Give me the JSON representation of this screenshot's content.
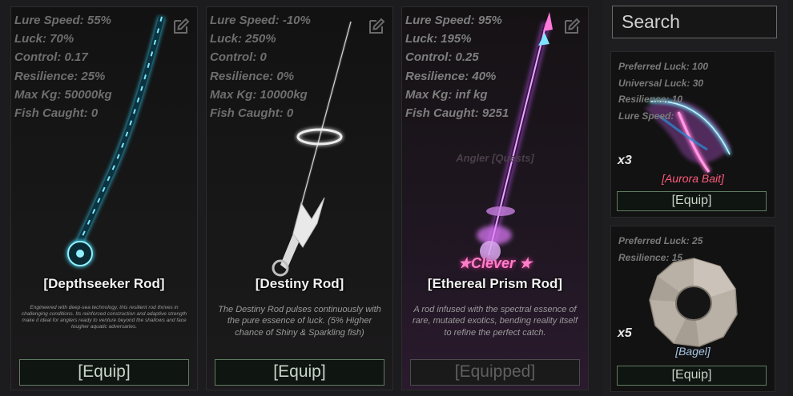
{
  "rods": [
    {
      "stats": [
        "Lure Speed: 55%",
        "Luck: 70%",
        "Control: 0.17",
        "Resilience: 25%",
        "Max Kg: 50000kg",
        "Fish Caught: 0"
      ],
      "name": "[Depthseeker Rod]",
      "description": "Engineered with deep-sea technology, this resilient rod thrives in challenging conditions. Its reinforced construction and adaptive strength make it ideal for anglers ready to venture beyond the shallows and face tougher aquatic adversaries.",
      "button_label": "[Equip]",
      "equipped": false
    },
    {
      "stats": [
        "Lure Speed: -10%",
        "Luck: 250%",
        "Control: 0",
        "Resilience: 0%",
        "Max Kg: 10000kg",
        "Fish Caught: 0"
      ],
      "name": "[Destiny Rod]",
      "description": "The Destiny Rod pulses continuously with the pure essence of luck. (5% Higher chance of Shiny & Sparkling fish)",
      "button_label": "[Equip]",
      "equipped": false
    },
    {
      "stats": [
        "Lure Speed: 95%",
        "Luck: 195%",
        "Control: 0.25",
        "Resilience: 40%",
        "Max Kg: inf kg",
        "Fish Caught: 9251"
      ],
      "name": "[Ethereal Prism Rod]",
      "mutation": "★Clever ★",
      "npc_label": "Angler [Quests]",
      "description": "A rod infused with the spectral essence of rare, mutated exotics, bending reality itself to refine the perfect catch.",
      "button_label": "[Equipped]",
      "equipped": true
    }
  ],
  "search": {
    "placeholder": "Search"
  },
  "baits": [
    {
      "stats": [
        "Preferred Luck: 100",
        "Universal Luck: 30",
        "Resilience: 10",
        "Lure Speed:"
      ],
      "quantity": "x3",
      "name": "[Aurora Bait]",
      "button_label": "[Equip]"
    },
    {
      "stats": [
        "Preferred Luck: 25",
        "Resilience: 15"
      ],
      "quantity": "x5",
      "name": "[Bagel]",
      "button_label": "[Equip]"
    }
  ],
  "colors": {
    "equip_border": "#5f7d63",
    "aurora_name": "#ff5a7c",
    "bagel_name": "#a7c4e4",
    "mutation": "#ff7ec8"
  },
  "icons": [
    "edit-icon"
  ]
}
